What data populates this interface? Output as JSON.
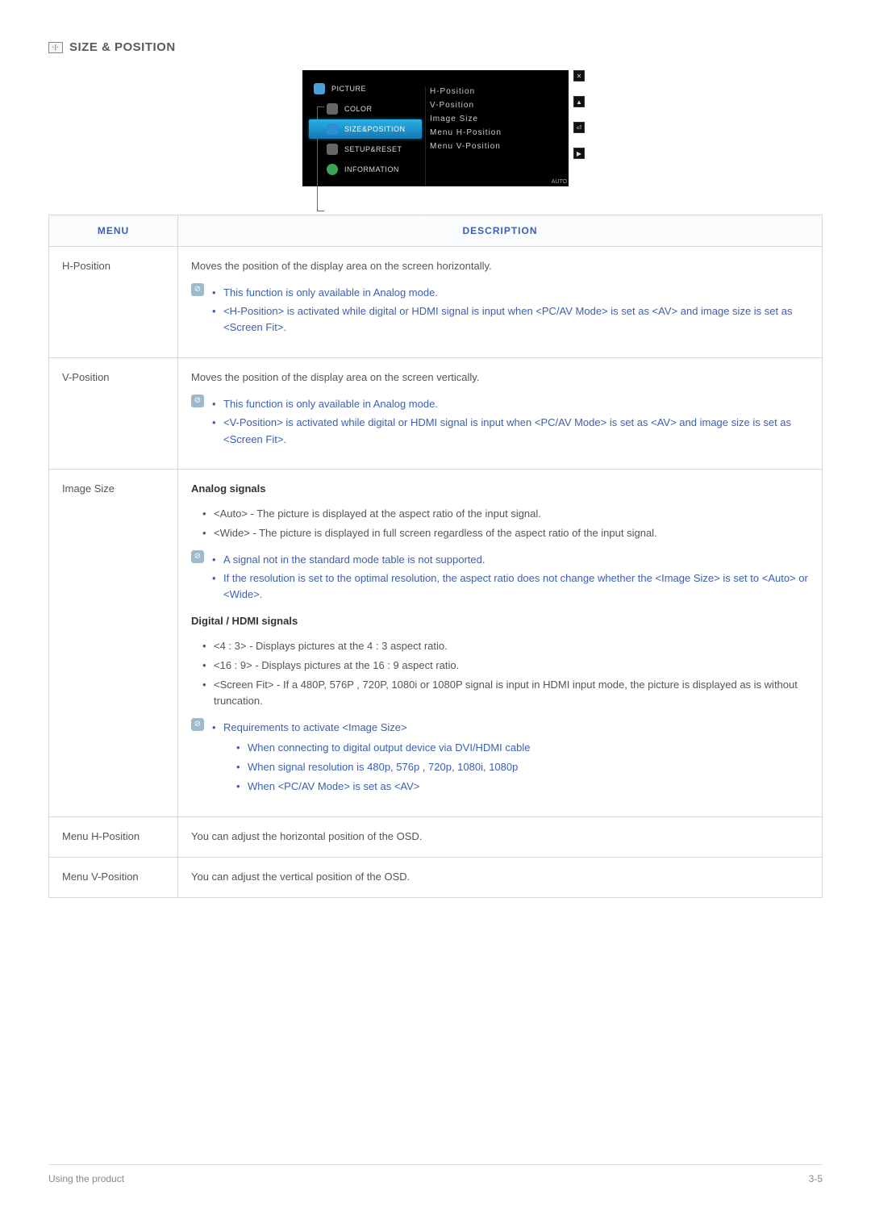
{
  "section": {
    "title": "SIZE & POSITION"
  },
  "osd": {
    "nav": [
      {
        "label": "PICTURE"
      },
      {
        "label": "COLOR"
      },
      {
        "label": "SIZE&POSITION"
      },
      {
        "label": "SETUP&RESET"
      },
      {
        "label": "INFORMATION"
      }
    ],
    "sub": [
      "H-Position",
      "V-Position",
      "Image Size",
      "Menu H-Position",
      "Menu V-Position"
    ],
    "side": [
      "✕",
      "▲",
      "⏎",
      "▶"
    ],
    "auto": "AUTO"
  },
  "table": {
    "headers": {
      "menu": "MENU",
      "desc": "DESCRIPTION"
    },
    "rows": {
      "hpos": {
        "menu": "H-Position",
        "lead": "Moves the position of the display area on the screen horizontally.",
        "notes": [
          "This function is only available in Analog mode.",
          "<H-Position> is activated while digital or HDMI signal is input when <PC/AV Mode> is set as <AV> and image size is set as <Screen Fit>."
        ]
      },
      "vpos": {
        "menu": "V-Position",
        "lead": "Moves the position of the display area on the screen vertically.",
        "notes": [
          "This function is only available in Analog mode.",
          "<V-Position> is activated while digital or HDMI signal is input when <PC/AV Mode> is set as <AV> and image size is set as <Screen Fit>."
        ]
      },
      "imagesize": {
        "menu": "Image Size",
        "analog_title": "Analog signals",
        "analog_items": [
          "<Auto> - The picture is displayed at the aspect ratio of the input signal.",
          "<Wide> - The picture is displayed in full screen regardless of the aspect ratio of the input signal."
        ],
        "analog_notes": [
          "A signal not in the standard mode table is not supported.",
          "If the resolution is set to the optimal resolution, the aspect ratio does not change whether the <Image Size> is set to <Auto> or <Wide>."
        ],
        "digital_title": "Digital / HDMI signals",
        "digital_items": [
          "<4 : 3> - Displays pictures at the 4 : 3 aspect ratio.",
          "<16 : 9> - Displays pictures at the 16 : 9 aspect ratio.",
          "<Screen Fit> - If a 480P, 576P , 720P, 1080i or 1080P signal is input in HDMI input mode, the picture is displayed as is without truncation."
        ],
        "digital_note_lead": "Requirements to activate <Image Size>",
        "digital_note_sub": [
          "When connecting to digital output device via DVI/HDMI cable",
          "When signal resolution is 480p, 576p , 720p, 1080i, 1080p",
          "When <PC/AV Mode> is set as <AV>"
        ]
      },
      "menuh": {
        "menu": "Menu H-Position",
        "desc": "You can adjust the horizontal position of the OSD."
      },
      "menuv": {
        "menu": "Menu V-Position",
        "desc": "You can adjust the vertical position of the OSD."
      }
    }
  },
  "footer": {
    "left": "Using the product",
    "right": "3-5"
  }
}
